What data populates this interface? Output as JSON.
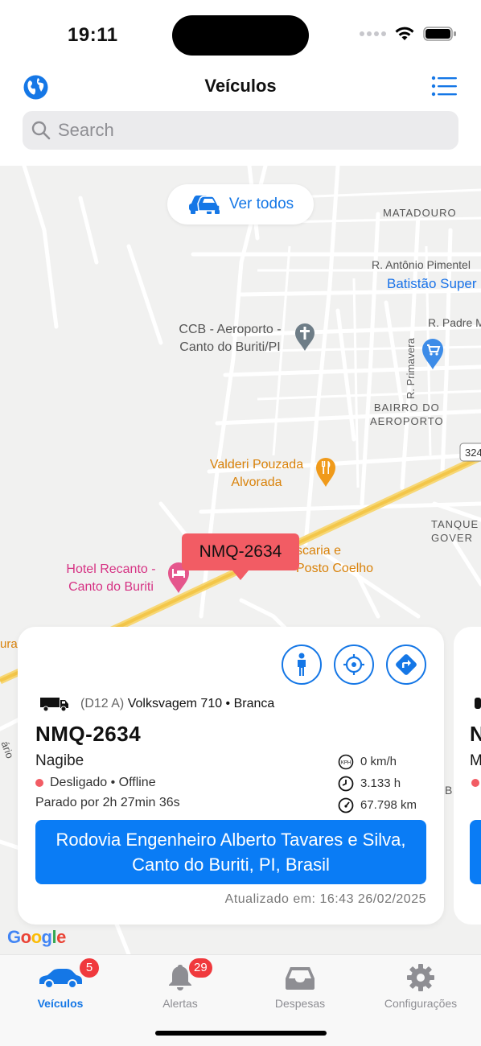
{
  "status_bar": {
    "time": "19:11"
  },
  "header": {
    "title": "Veículos"
  },
  "search": {
    "placeholder": "Search"
  },
  "map": {
    "ver_todos_label": "Ver todos",
    "labels": {
      "matadouro": "MATADOURO",
      "rua_antonio": "R. Antônio Pimentel",
      "batistao": "Batistão Super",
      "ccb_1": "CCB - Aeroporto -",
      "ccb_2": "Canto do Buriti/PI",
      "rua_padre": "R. Padre Ma",
      "rua_primavera": "R. Primavera",
      "bairro_1": "BAIRRO DO",
      "bairro_2": "AEROPORTO",
      "road_number": "324",
      "valderi_1": "Valderi Pouzada",
      "valderi_2": "Alvorada",
      "tanque_1": "TANQUE",
      "tanque_2": "GOVER",
      "churrascaria_1": "scaria e",
      "churrascaria_2": "Posto Coelho",
      "hotel_1": "Hotel Recanto -",
      "hotel_2": "Canto do Buriti",
      "left_road": "ura",
      "left_rua": "ário",
      "google": "Google"
    },
    "marker_plate": "NMQ-2634"
  },
  "vehicle_card": {
    "vehicle_code": "(D12 A)",
    "vehicle_model": "Volksvagem 710 • Branca",
    "plate": "NMQ-2634",
    "driver": "Nagibe",
    "status": "Desligado • Offline",
    "parked": "Parado por 2h 27min 36s",
    "speed": "0 km/h",
    "hours": "3.133 h",
    "odometer": "67.798 km",
    "address": "Rodovia Engenheiro Alberto Tavares e Silva, Canto do Buriti, PI, Brasil",
    "updated": "Atualizado em: 16:43 26/02/2025",
    "status_color": "#f25c64"
  },
  "next_card": {
    "plate_initial": "N",
    "driver_initial": "M",
    "letter_b": "B"
  },
  "tabbar": {
    "tabs": [
      {
        "label": "Veículos",
        "badge": "5"
      },
      {
        "label": "Alertas",
        "badge": "29"
      },
      {
        "label": "Despesas"
      },
      {
        "label": "Configurações"
      }
    ]
  },
  "colors": {
    "accent": "#1577e6",
    "badge": "#f0393d",
    "marker": "#f25c64"
  }
}
